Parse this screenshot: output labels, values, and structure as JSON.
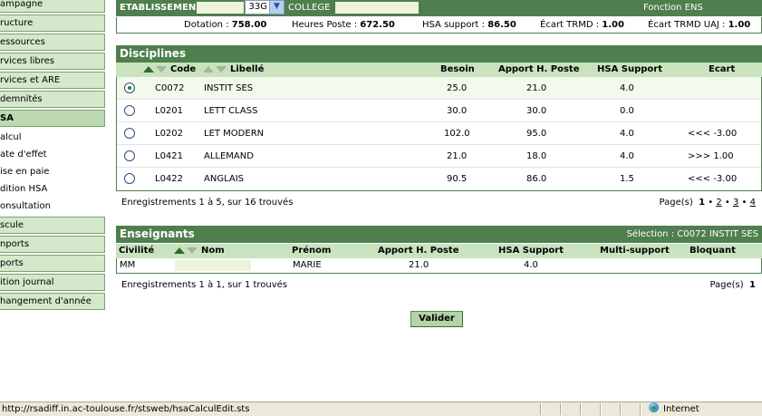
{
  "sidebar": {
    "items": [
      {
        "label": "ampagne",
        "type": "main"
      },
      {
        "label": "ructure",
        "type": "main"
      },
      {
        "label": "essources",
        "type": "main"
      },
      {
        "label": "rvices libres",
        "type": "main"
      },
      {
        "label": "rvices et ARE",
        "type": "main"
      },
      {
        "label": "demnités",
        "type": "main"
      },
      {
        "label": "SA",
        "type": "main"
      }
    ],
    "subitems": [
      {
        "label": "alcul"
      },
      {
        "label": "ate d'effet"
      },
      {
        "label": "ise en paie"
      },
      {
        "label": "dition HSA"
      },
      {
        "label": "onsultation"
      }
    ],
    "items2": [
      {
        "label": "scule"
      },
      {
        "label": "nports"
      },
      {
        "label": "ports"
      },
      {
        "label": "ition journal"
      },
      {
        "label": "hangement d'année"
      }
    ]
  },
  "header": {
    "etab_label": "ETABLISSEMEN",
    "etab_code_suffix": "33G",
    "college_label": "COLLEGE",
    "fonction": "Fonction ENS"
  },
  "stats": {
    "dotation_label": "Dotation :",
    "dotation_value": "758.00",
    "heures_label": "Heures Poste :",
    "heures_value": "672.50",
    "hsa_label": "HSA support :",
    "hsa_value": "86.50",
    "ecart_label": "Écart TRMD :",
    "ecart_value": "1.00",
    "ecart_uaj_label": "Écart TRMD UAJ :",
    "ecart_uaj_value": "1.00"
  },
  "disciplines": {
    "title": "Disciplines",
    "columns": {
      "code": "Code",
      "libelle": "Libellé",
      "besoin": "Besoin",
      "apport": "Apport H. Poste",
      "hsa": "HSA Support",
      "ecart": "Ecart"
    },
    "rows": [
      {
        "code": "C0072",
        "libelle": "INSTIT SES",
        "besoin": "25.0",
        "apport": "21.0",
        "hsa": "4.0",
        "ecart": "",
        "selected": true
      },
      {
        "code": "L0201",
        "libelle": "LETT CLASS",
        "besoin": "30.0",
        "apport": "30.0",
        "hsa": "0.0",
        "ecart": "",
        "selected": false
      },
      {
        "code": "L0202",
        "libelle": "LET MODERN",
        "besoin": "102.0",
        "apport": "95.0",
        "hsa": "4.0",
        "ecart": "<<< -3.00",
        "selected": false
      },
      {
        "code": "L0421",
        "libelle": "ALLEMAND",
        "besoin": "21.0",
        "apport": "18.0",
        "hsa": "4.0",
        "ecart": ">>> 1.00",
        "selected": false
      },
      {
        "code": "L0422",
        "libelle": "ANGLAIS",
        "besoin": "90.5",
        "apport": "86.0",
        "hsa": "1.5",
        "ecart": "<<< -3.00",
        "selected": false
      }
    ],
    "records_text": "Enregistrements 1 à 5, sur 16 trouvés",
    "pages_label": "Page(s)",
    "current_page": "1",
    "other_pages": [
      "2",
      "3",
      "4"
    ]
  },
  "enseignants": {
    "title": "Enseignants",
    "selection_text": "Sélection : C0072 INSTIT SES",
    "columns": {
      "civilite": "Civilité",
      "nom": "Nom",
      "prenom": "Prénom",
      "apport": "Apport H. Poste",
      "hsa": "HSA Support",
      "multi": "Multi-support",
      "bloquant": "Bloquant"
    },
    "rows": [
      {
        "civilite": "MM",
        "nom": "",
        "prenom": "MARIE",
        "apport": "21.0",
        "hsa": "4.0",
        "multi": "",
        "bloquant": ""
      }
    ],
    "records_text": "Enregistrements 1 à 1, sur 1 trouvés",
    "pages_label": "Page(s)",
    "current_page": "1"
  },
  "valider_label": "Valider",
  "statusbar": {
    "url": "http://rsadiff.in.ac-toulouse.fr/stsweb/hsaCalculEdit.sts",
    "zone": "Internet"
  },
  "colors": {
    "header_green": "#4f7f4e",
    "column_header_green": "#c9e3bf",
    "sidebar_green": "#d4e8cc"
  }
}
